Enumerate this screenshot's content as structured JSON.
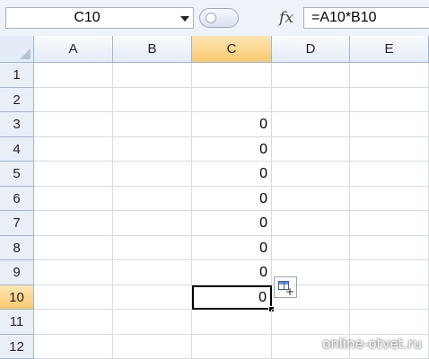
{
  "formula_bar": {
    "name_box": "C10",
    "fx_label": "fx",
    "formula": "=A10*B10"
  },
  "columns": [
    "A",
    "B",
    "C",
    "D",
    "E"
  ],
  "active_column": "C",
  "rows": [
    {
      "label": "1",
      "c_value": ""
    },
    {
      "label": "2",
      "c_value": ""
    },
    {
      "label": "3",
      "c_value": "0"
    },
    {
      "label": "4",
      "c_value": "0"
    },
    {
      "label": "5",
      "c_value": "0"
    },
    {
      "label": "6",
      "c_value": "0"
    },
    {
      "label": "7",
      "c_value": "0"
    },
    {
      "label": "8",
      "c_value": "0"
    },
    {
      "label": "9",
      "c_value": "0"
    },
    {
      "label": "10",
      "c_value": "0"
    },
    {
      "label": "11",
      "c_value": ""
    },
    {
      "label": "12",
      "c_value": ""
    }
  ],
  "active_row": "10",
  "watermark": "online-otvet.ru"
}
